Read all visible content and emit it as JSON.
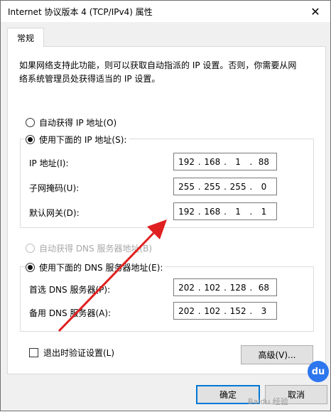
{
  "window": {
    "title": "Internet 协议版本 4 (TCP/IPv4) 属性",
    "close_glyph": "✕"
  },
  "tabs": [
    {
      "label": "常规"
    }
  ],
  "description": {
    "line1": "如果网络支持此功能，则可以获取自动指派的 IP 设置。否则，你需要从网",
    "line2": "络系统管理员处获得适当的 IP 设置。"
  },
  "ip_section": {
    "auto_label": "自动获得 IP 地址(O)",
    "auto_selected": false,
    "manual_label": "使用下面的 IP 地址(S):",
    "manual_selected": true,
    "fields": [
      {
        "label": "IP 地址(I):",
        "octets": [
          "192",
          "168",
          "1",
          "88"
        ]
      },
      {
        "label": "子网掩码(U):",
        "octets": [
          "255",
          "255",
          "255",
          "0"
        ]
      },
      {
        "label": "默认网关(D):",
        "octets": [
          "192",
          "168",
          "1",
          "1"
        ]
      }
    ]
  },
  "dns_section": {
    "auto_label": "自动获得 DNS 服务器地址(B)",
    "auto_selected": false,
    "auto_disabled": true,
    "manual_label": "使用下面的 DNS 服务器地址(E):",
    "manual_selected": true,
    "fields": [
      {
        "label": "首选 DNS 服务器(P):",
        "octets": [
          "202",
          "102",
          "128",
          "68"
        ]
      },
      {
        "label": "备用 DNS 服务器(A):",
        "octets": [
          "202",
          "102",
          "152",
          "3"
        ]
      }
    ]
  },
  "validate_checkbox": {
    "label": "退出时验证设置(L)",
    "checked": false
  },
  "buttons": {
    "advanced": "高级(V)...",
    "ok": "确定",
    "cancel": "取消"
  },
  "watermark": {
    "logo": "du",
    "text": "Baidu 经验"
  },
  "colors": {
    "accent": "#0078d7",
    "arrow": "#e02020"
  }
}
